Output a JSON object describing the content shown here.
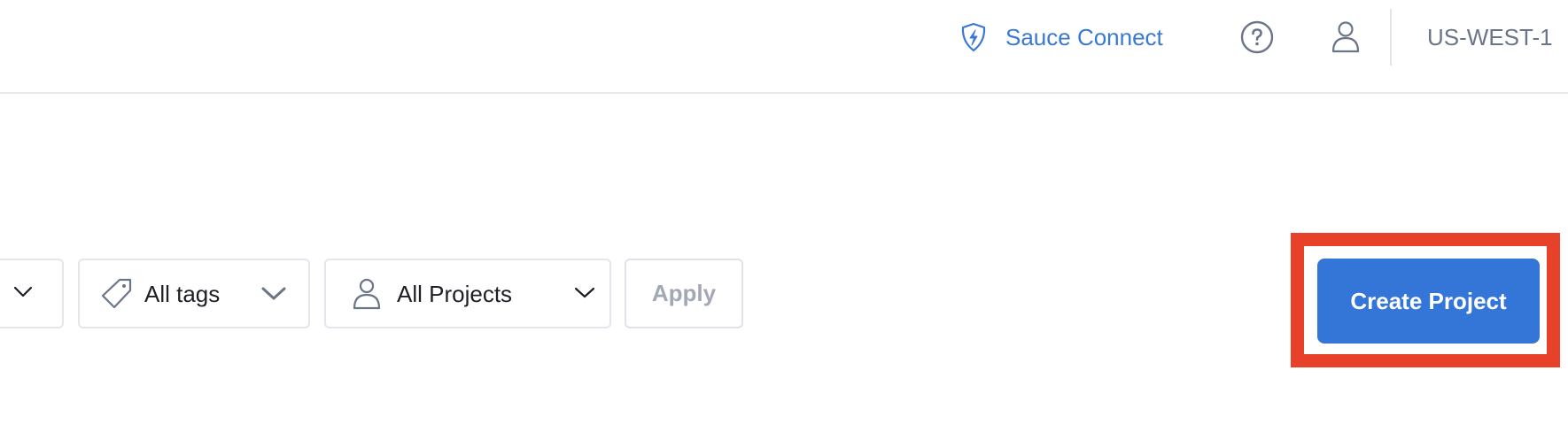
{
  "header": {
    "sauce_connect": {
      "label": "Sauce Connect",
      "icon": "shield-bolt-icon"
    },
    "help": {
      "icon": "help-circle-icon"
    },
    "account": {
      "icon": "user-icon"
    },
    "region": "US-WEST-1"
  },
  "filters": {
    "first_dropdown": {
      "icon": "chevron-down-icon"
    },
    "tags": {
      "label": "All tags",
      "icon": "tag-icon"
    },
    "projects": {
      "label": "All Projects",
      "icon": "user-icon"
    },
    "apply_label": "Apply"
  },
  "actions": {
    "create_project_label": "Create Project"
  },
  "colors": {
    "accent": "#3475d8",
    "link": "#3a78d6",
    "highlight": "#e8412a",
    "muted": "#6b7588",
    "disabled_text": "#a3a8b5",
    "border": "#e4e6ec"
  }
}
